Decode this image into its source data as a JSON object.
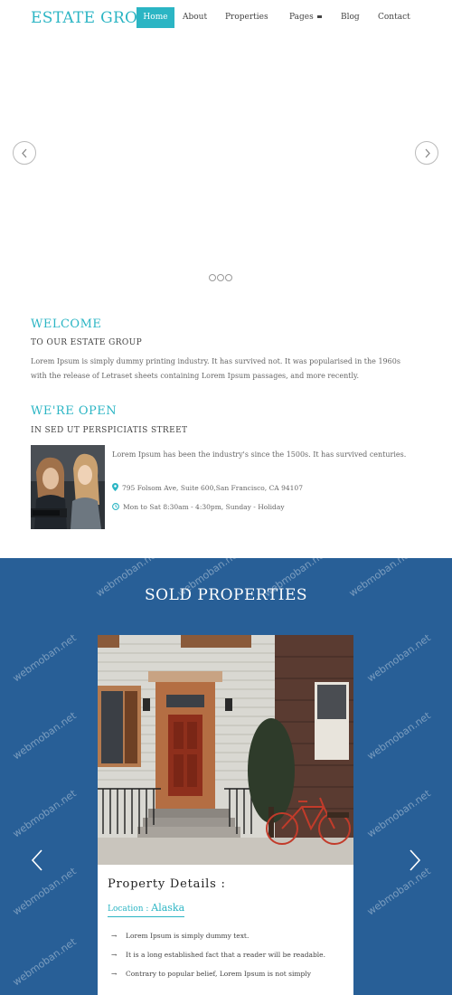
{
  "brand": {
    "name": "ESTATE GROUP",
    "accent": "#2bb5c4",
    "sold_bg": "#285f97"
  },
  "nav": {
    "items": [
      {
        "label": "Home",
        "active": true
      },
      {
        "label": "About"
      },
      {
        "label": "Properties"
      },
      {
        "label": "Pages"
      },
      {
        "label": "Blog"
      },
      {
        "label": "Contact"
      }
    ]
  },
  "slider": {
    "prev_icon": "circle-chevron-left-icon",
    "next_icon": "circle-chevron-right-icon",
    "dot_count": 3
  },
  "welcome": {
    "title": "WELCOME",
    "subtitle": "TO OUR ESTATE GROUP",
    "text": "Lorem Ipsum is simply dummy printing industry. It has survived not. It was popularised in the 1960s with the release of Letraset sheets containing Lorem Ipsum passages, and more recently."
  },
  "open": {
    "title": "WE'RE OPEN",
    "subtitle": "IN SED UT PERSPICIATIS STREET",
    "text": "Lorem Ipsum has been the industry's since the 1500s. It has survived centuries.",
    "address": "795 Folsom Ave, Suite 600,San Francisco, CA 94107",
    "hours": "Mon to Sat 8:30am - 4:30pm, Sunday - Holiday",
    "address_icon": "map-pin-icon",
    "hours_icon": "clock-icon"
  },
  "sold": {
    "title": "SOLD PROPERTIES",
    "card": {
      "heading": "Property Details :",
      "location_label": "Location : ",
      "location_value": "Alaska",
      "bullets": [
        "Lorem Ipsum is simply dummy text.",
        "It is a long established fact that a reader will be readable.",
        "Contrary to popular belief, Lorem Ipsum is not simply"
      ]
    },
    "watermark": "webmoban.net"
  }
}
